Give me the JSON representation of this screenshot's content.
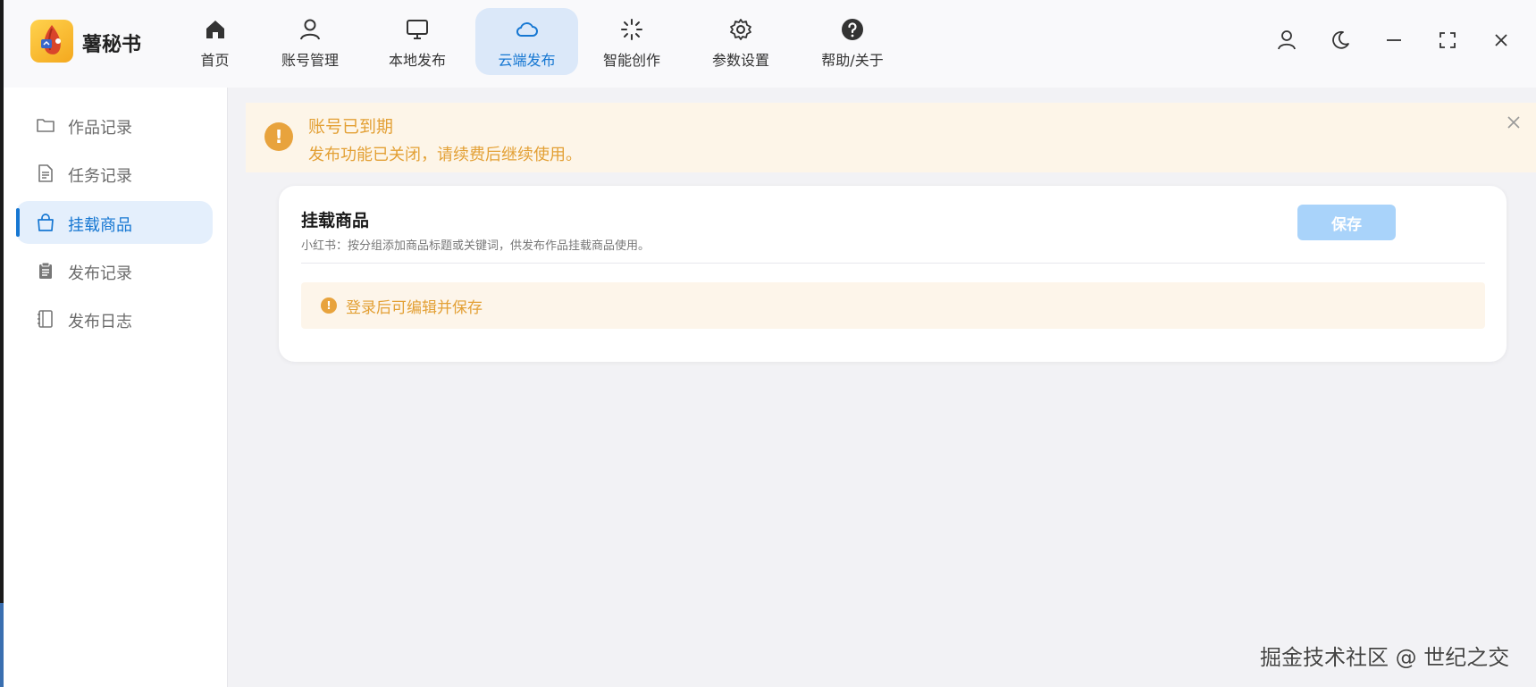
{
  "app": {
    "name": "薯秘书"
  },
  "nav": {
    "items": [
      {
        "label": "首页",
        "icon": "home-icon"
      },
      {
        "label": "账号管理",
        "icon": "user-icon"
      },
      {
        "label": "本地发布",
        "icon": "monitor-icon"
      },
      {
        "label": "云端发布",
        "icon": "cloud-icon",
        "active": true
      },
      {
        "label": "智能创作",
        "icon": "sparkle-icon"
      },
      {
        "label": "参数设置",
        "icon": "gear-icon"
      },
      {
        "label": "帮助/关于",
        "icon": "help-icon"
      }
    ]
  },
  "window_controls": [
    "user-icon",
    "moon-icon",
    "minimize-icon",
    "fullscreen-icon",
    "close-icon"
  ],
  "sidebar": {
    "items": [
      {
        "label": "作品记录",
        "icon": "folder-icon"
      },
      {
        "label": "任务记录",
        "icon": "document-icon"
      },
      {
        "label": "挂载商品",
        "icon": "shopping-bag-icon",
        "active": true
      },
      {
        "label": "发布记录",
        "icon": "clipboard-icon"
      },
      {
        "label": "发布日志",
        "icon": "notebook-icon"
      }
    ]
  },
  "banner": {
    "icon": "!",
    "title": "账号已到期",
    "message": "发布功能已关闭，请续费后继续使用。"
  },
  "card": {
    "title": "挂载商品",
    "subtitle": "小红书：按分组添加商品标题或关键词，供发布作品挂载商品使用。",
    "save_label": "保存",
    "notice_icon": "!",
    "notice": "登录后可编辑并保存"
  },
  "watermark": "掘金技术社区 @ 世纪之交",
  "colors": {
    "accent": "#1677d2",
    "active_bg": "#dbe8f9",
    "warning": "#e3a035",
    "warning_bg": "#fdf5e8",
    "save_disabled": "#a9d3fa"
  }
}
